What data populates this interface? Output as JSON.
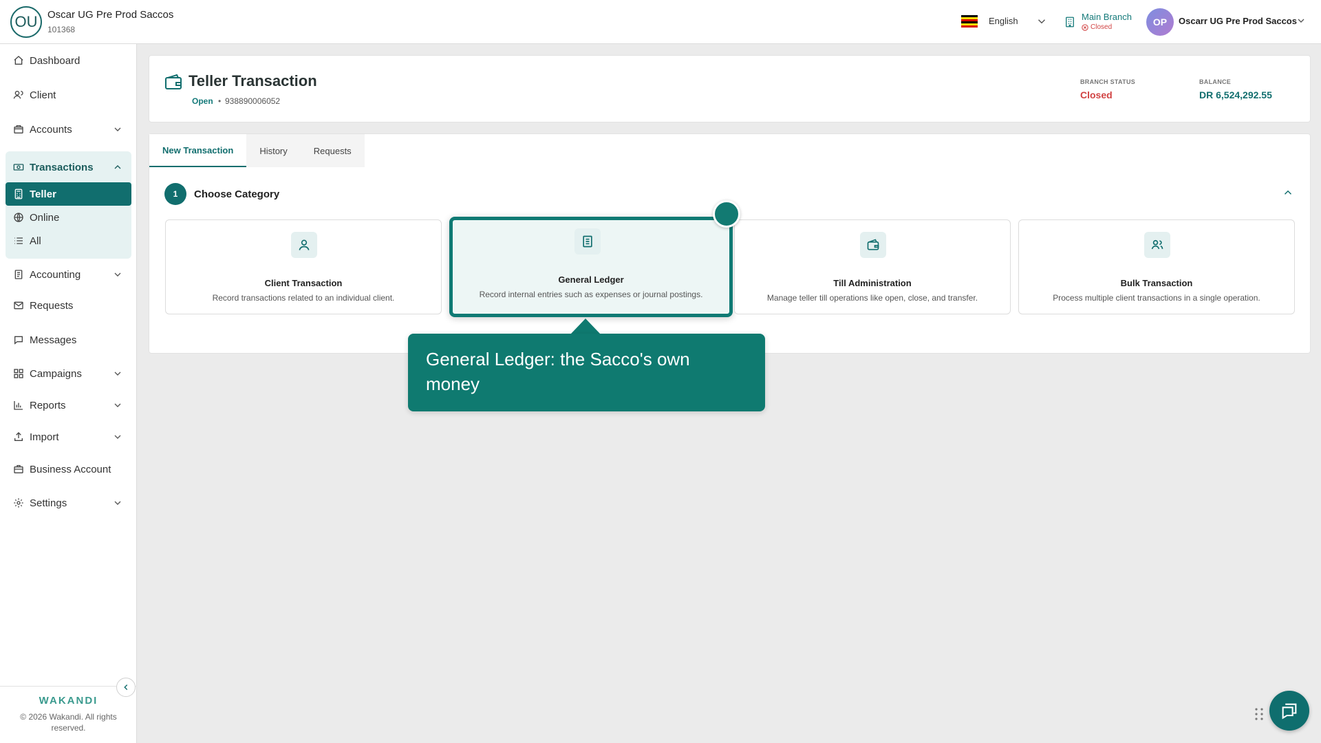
{
  "header": {
    "org_initials": "OU",
    "org_name": "Oscar UG Pre Prod Saccos",
    "org_id": "101368",
    "language": "English",
    "branch_name": "Main Branch",
    "branch_status": "Closed",
    "user_initials": "OP",
    "user_name": "Oscarr UG Pre Prod Saccos"
  },
  "sidebar": {
    "dashboard": "Dashboard",
    "client": "Client",
    "accounts": "Accounts",
    "transactions": "Transactions",
    "teller": "Teller",
    "online": "Online",
    "all": "All",
    "accounting": "Accounting",
    "requests": "Requests",
    "messages": "Messages",
    "campaigns": "Campaigns",
    "reports": "Reports",
    "import": "Import",
    "business_account": "Business Account",
    "settings": "Settings"
  },
  "footer": {
    "brand": "WAKANDI",
    "copyright": "© 2026 Wakandi. All rights reserved."
  },
  "page": {
    "title": "Teller Transaction",
    "till_state": "Open",
    "separator": "•",
    "till_id": "938890006052",
    "branch_status_label": "BRANCH STATUS",
    "branch_status_value": "Closed",
    "balance_label": "BALANCE",
    "balance_value": "DR 6,524,292.55"
  },
  "tabs": [
    "New Transaction",
    "History",
    "Requests"
  ],
  "step": {
    "number": "1",
    "title": "Choose Category"
  },
  "categories": [
    {
      "title": "Client Transaction",
      "desc": "Record transactions related to an individual client.",
      "icon": "person-icon"
    },
    {
      "title": "General Ledger",
      "desc": "Record internal entries such as expenses or journal postings.",
      "icon": "ledger-icon"
    },
    {
      "title": "Till Administration",
      "desc": "Manage teller till operations like open, close, and transfer.",
      "icon": "wallet-icon"
    },
    {
      "title": "Bulk Transaction",
      "desc": "Process multiple client transactions in a single operation.",
      "icon": "group-icon"
    }
  ],
  "tooltip": {
    "text": "General Ledger: the Sacco's own money"
  },
  "colors": {
    "primary": "#116e6e",
    "closed": "#d14343",
    "highlight": "#0f7a74"
  }
}
